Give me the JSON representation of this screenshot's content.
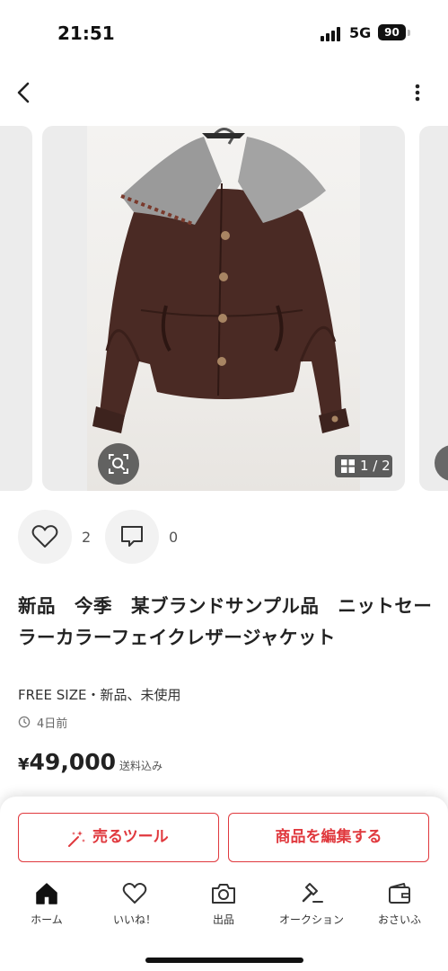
{
  "status_bar": {
    "time": "21:51",
    "network": "5G",
    "battery": "90"
  },
  "gallery": {
    "counter": "1 / 2"
  },
  "reactions": {
    "likes": "2",
    "comments": "0"
  },
  "item": {
    "title": "新品　今季　某ブランドサンプル品　ニットセーラーカラーフェイクレザージャケット",
    "size_condition": "FREE SIZE・新品、未使用",
    "posted": "4日前",
    "currency": "¥",
    "price": "49,000",
    "shipping": "送料込み"
  },
  "actions": {
    "sell_tool": "売るツール",
    "edit_item": "商品を編集する"
  },
  "tabs": [
    {
      "label": "ホーム",
      "icon": "home-icon",
      "active": true
    },
    {
      "label": "いいね！",
      "icon": "heart-icon"
    },
    {
      "label": "出品",
      "icon": "camera-icon"
    },
    {
      "label": "オークション",
      "icon": "gavel-icon"
    },
    {
      "label": "おさいふ",
      "icon": "wallet-icon"
    }
  ],
  "colors": {
    "accent": "#e0393e",
    "jacket_leather": "#4a2a24",
    "collar_knit": "#9a9a9a"
  }
}
